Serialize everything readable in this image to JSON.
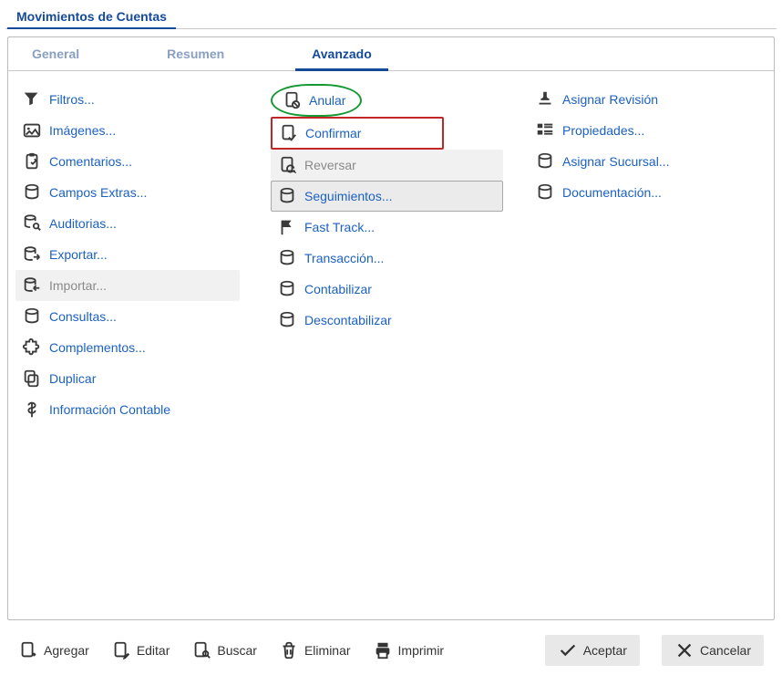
{
  "window": {
    "title": "Movimientos de Cuentas"
  },
  "tabs": {
    "general": "General",
    "resumen": "Resumen",
    "avanzado": "Avanzado",
    "active": "avanzado"
  },
  "col1": {
    "filtros": "Filtros...",
    "imagenes": "Imágenes...",
    "comentarios": "Comentarios...",
    "campos_extras": "Campos Extras...",
    "auditorias": "Auditorias...",
    "exportar": "Exportar...",
    "importar": "Importar...",
    "consultas": "Consultas...",
    "complementos": "Complementos...",
    "duplicar": "Duplicar",
    "info_contable": "Información Contable"
  },
  "col2": {
    "anular": "Anular",
    "confirmar": "Confirmar",
    "reversar": "Reversar",
    "seguimientos": "Seguimientos...",
    "fast_track": "Fast Track...",
    "transaccion": "Transacción...",
    "contabilizar": "Contabilizar",
    "descontabilizar": "Descontabilizar"
  },
  "col3": {
    "asignar_revision": "Asignar Revisión",
    "propiedades": "Propiedades...",
    "asignar_sucursal": "Asignar Sucursal...",
    "documentacion": "Documentación..."
  },
  "toolbar": {
    "agregar": "Agregar",
    "editar": "Editar",
    "buscar": "Buscar",
    "eliminar": "Eliminar",
    "imprimir": "Imprimir",
    "aceptar": "Aceptar",
    "cancelar": "Cancelar"
  }
}
